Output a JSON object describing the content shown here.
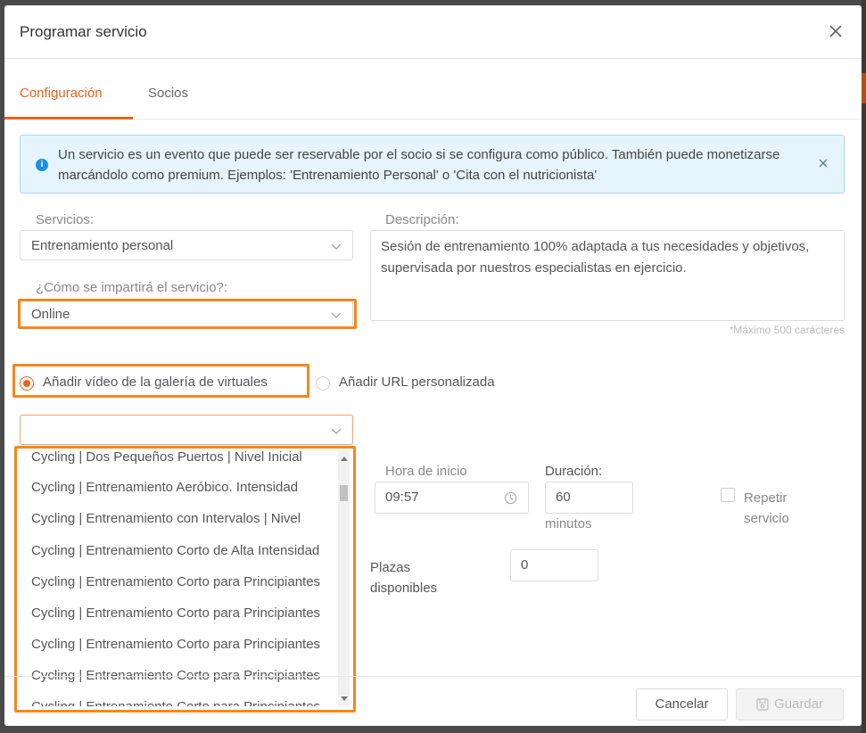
{
  "modal": {
    "title": "Programar servicio"
  },
  "tabs": [
    {
      "label": "Configuración",
      "active": true
    },
    {
      "label": "Socios",
      "active": false
    }
  ],
  "alert": {
    "text": "Un servicio es un evento que puede ser reservable por el socio si se configura como público. También puede monetizarse marcándolo como premium. Ejemplos: 'Entrenamiento Personal' o 'Cita con el nutricionista'"
  },
  "form": {
    "servicios_label": "Servicios:",
    "servicios_value": "Entrenamiento personal",
    "descripcion_label": "Descripción:",
    "descripcion_value": "Sesión de entrenamiento 100% adaptada a tus necesidades y objetivos, supervisada por nuestros especialistas en ejercicio.",
    "descripcion_hint": "*Máximo 500 carácteres",
    "modo_label": "¿Cómo se impartirá el servicio?:",
    "modo_value": "Online",
    "radio_gallery_label": "Añadir vídeo de la galería de virtuales",
    "radio_url_label": "Añadir URL personalizada",
    "video_value": "",
    "hora_label": "Hora de inicio",
    "hora_value": "09:57",
    "duracion_label": "Duración:",
    "duracion_value": "60",
    "duracion_unit": "minutos",
    "plazas_label": "Plazas disponibles",
    "plazas_value": "0",
    "repetir_label": "Repetir servicio"
  },
  "dropdown_items": [
    "Cycling | Dos Pequeños Puertos | Nivel Inicial",
    "Cycling | Entrenamiento Aeróbico. Intensidad",
    "Cycling | Entrenamiento con Intervalos | Nivel",
    "Cycling | Entrenamiento Corto de Alta Intensidad",
    "Cycling | Entrenamiento Corto para Principiantes",
    "Cycling | Entrenamiento Corto para Principiantes",
    "Cycling | Entrenamiento Corto para Principiantes",
    "Cycling | Entrenamiento Corto para Principiantes",
    "Cycling | Entrenamiento Corto para Principiantes"
  ],
  "footer": {
    "cancel_label": "Cancelar",
    "save_label": "Guardar"
  },
  "colors": {
    "accent": "#e8621a",
    "highlight": "#f7861c",
    "info_bg": "#e6f4fd",
    "info_icon": "#1a8fe3"
  }
}
